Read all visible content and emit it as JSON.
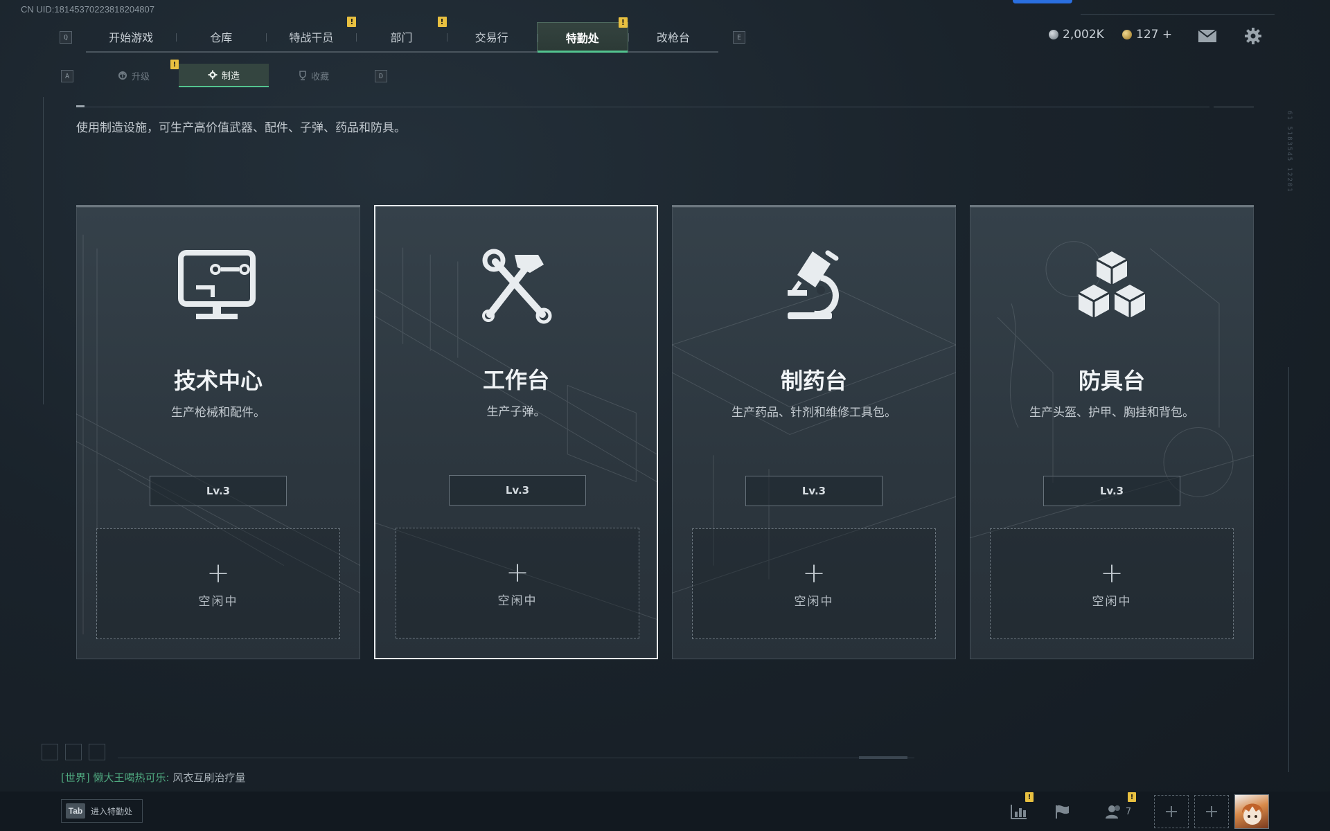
{
  "uid": "CN UID:18145370223818204807",
  "keys": {
    "prev_main": "Q",
    "next_main": "E",
    "prev_sub": "A",
    "next_sub": "D"
  },
  "main_tabs": [
    {
      "label": "开始游戏",
      "alert": false
    },
    {
      "label": "仓库",
      "alert": false
    },
    {
      "label": "特战干员",
      "alert": true
    },
    {
      "label": "部门",
      "alert": true
    },
    {
      "label": "交易行",
      "alert": false
    },
    {
      "label": "特勤处",
      "alert": true,
      "active": true
    },
    {
      "label": "改枪台",
      "alert": false
    }
  ],
  "alert_glyph": "!",
  "currency": {
    "silver": "2,002K",
    "gold": "127 +",
    "silver_color": "#9aa4ac",
    "gold_color": "#c9a24a"
  },
  "sub_tabs": [
    {
      "label": "升级",
      "icon": "upgrade-icon",
      "alert": true
    },
    {
      "label": "制造",
      "icon": "gear-icon",
      "active": true
    },
    {
      "label": "收藏",
      "icon": "trophy-icon"
    }
  ],
  "description": "使用制造设施，可生产高价值武器、配件、子弹、药品和防具。",
  "side_code": "61 5183545 12201",
  "stations": [
    {
      "title": "技术中心",
      "subtitle": "生产枪械和配件。",
      "level": "Lv.3",
      "status": "空闲中",
      "icon": "computer-icon"
    },
    {
      "title": "工作台",
      "subtitle": "生产子弹。",
      "level": "Lv.3",
      "status": "空闲中",
      "icon": "hammer-wrench-icon",
      "selected": true
    },
    {
      "title": "制药台",
      "subtitle": "生产药品、针剂和维修工具包。",
      "level": "Lv.3",
      "status": "空闲中",
      "icon": "microscope-icon"
    },
    {
      "title": "防具台",
      "subtitle": "生产头盔、护甲、胸挂和背包。",
      "level": "Lv.3",
      "status": "空闲中",
      "icon": "boxes-icon"
    }
  ],
  "slot_plus": "+",
  "chat": {
    "channel": "[世界]",
    "sender": "懒大王喝热可乐:",
    "message": "风衣互刷治疗量"
  },
  "tab_hint": {
    "key": "Tab",
    "label": "进入特勤处"
  },
  "friends_count": "7",
  "accent_color": "#53c48f",
  "alert_color": "#e8c040"
}
